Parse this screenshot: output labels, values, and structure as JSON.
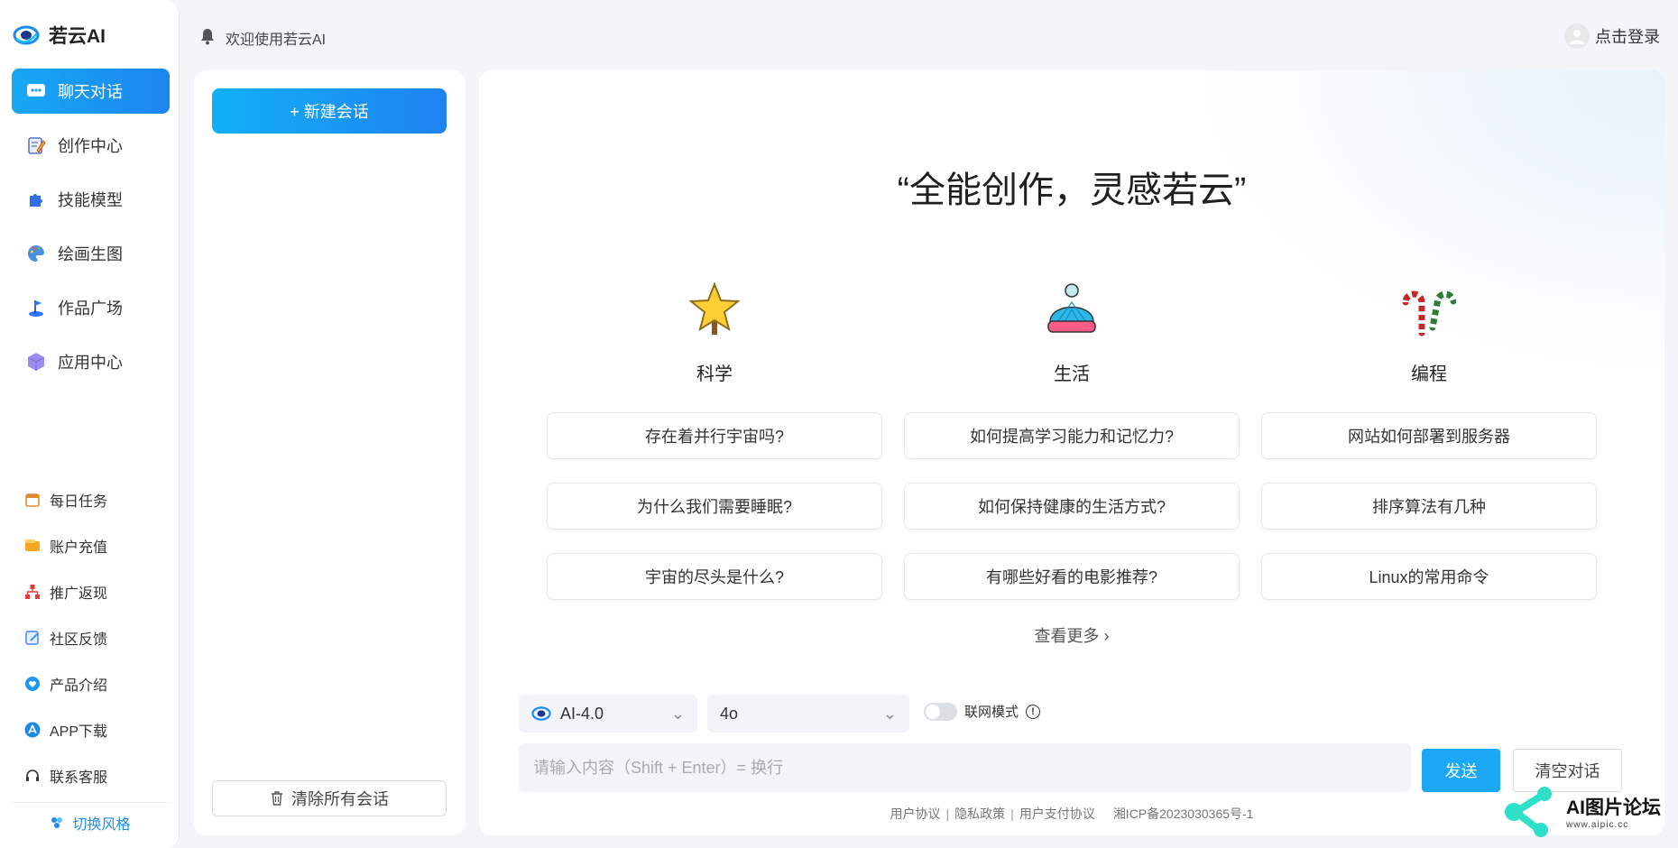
{
  "app": {
    "name": "若云AI"
  },
  "topbar": {
    "welcome": "欢迎使用若云AI",
    "login_label": "点击登录"
  },
  "sidebar": {
    "nav": [
      {
        "label": "聊天对话",
        "icon": "chat-bubble-icon",
        "active": true
      },
      {
        "label": "创作中心",
        "icon": "pencil-notepad-icon",
        "active": false
      },
      {
        "label": "技能模型",
        "icon": "puzzle-icon",
        "active": false
      },
      {
        "label": "绘画生图",
        "icon": "palette-icon",
        "active": false
      },
      {
        "label": "作品广场",
        "icon": "flag-icon",
        "active": false
      },
      {
        "label": "应用中心",
        "icon": "cube-icon",
        "active": false
      }
    ],
    "tools": [
      {
        "label": "每日任务",
        "icon": "calendar-icon"
      },
      {
        "label": "账户充值",
        "icon": "wallet-icon"
      },
      {
        "label": "推广返现",
        "icon": "org-chart-icon"
      },
      {
        "label": "社区反馈",
        "icon": "edit-note-icon"
      },
      {
        "label": "产品介绍",
        "icon": "heart-shield-icon"
      },
      {
        "label": "APP下载",
        "icon": "app-store-icon"
      },
      {
        "label": "联系客服",
        "icon": "headset-icon"
      }
    ],
    "switch_style": "切换风格"
  },
  "conversations": {
    "new_chat": "+ 新建会话",
    "clear_all": "清除所有会话"
  },
  "main": {
    "hero_title": "“全能创作，灵感若云”",
    "categories": [
      {
        "title": "科学",
        "icon": "star-wand-icon",
        "questions": [
          "存在着并行宇宙吗?",
          "为什么我们需要睡眠?",
          "宇宙的尽头是什么?"
        ]
      },
      {
        "title": "生活",
        "icon": "beanie-hat-icon",
        "questions": [
          "如何提高学习能力和记忆力?",
          "如何保持健康的生活方式?",
          "有哪些好看的电影推荐?"
        ]
      },
      {
        "title": "编程",
        "icon": "candy-cane-icon",
        "questions": [
          "网站如何部署到服务器",
          "排序算法有几种",
          "Linux的常用命令"
        ]
      }
    ],
    "more_label": "查看更多",
    "model_select": "AI-4.0",
    "submodel_select": "4o",
    "web_mode_label": "联网模式",
    "input_placeholder": "请输入内容（Shift + Enter）= 换行",
    "send_label": "发送",
    "clear_chat_label": "清空对话",
    "footer": {
      "user_agreement": "用户协议",
      "privacy": "隐私政策",
      "payment": "用户支付协议",
      "icp": "湘ICP备2023030365号-1"
    }
  },
  "watermark": {
    "title": "AI图片论坛",
    "url": "www.aipic.cc"
  },
  "colors": {
    "accent": "#1aa7f5",
    "accent_dark": "#1e82f1",
    "background": "#f3f5f9"
  }
}
